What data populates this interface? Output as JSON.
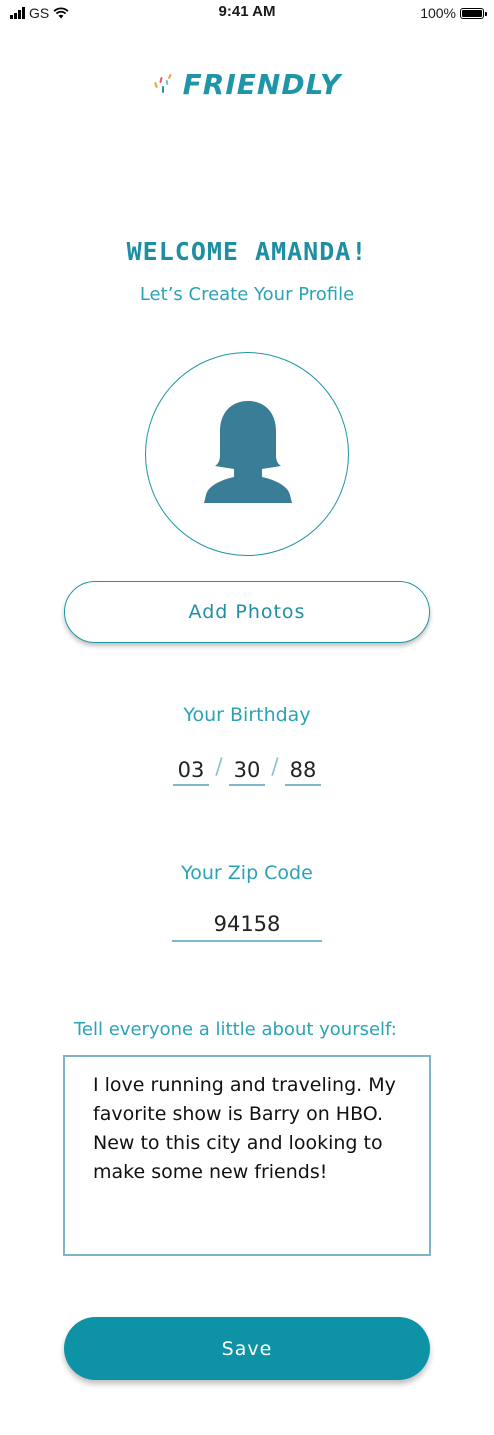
{
  "status_bar": {
    "carrier": "GS",
    "time": "9:41 AM",
    "battery": "100%"
  },
  "app": {
    "name": "FRIENDLY"
  },
  "header": {
    "welcome": "WELCOME AMANDA!",
    "subtitle": "Let’s Create Your Profile"
  },
  "photo": {
    "add_label": "Add Photos"
  },
  "birthday": {
    "label": "Your Birthday",
    "month": "03",
    "day": "30",
    "year": "88",
    "separator": "/"
  },
  "zip": {
    "label": "Your Zip Code",
    "value": "94158"
  },
  "about": {
    "label": "Tell everyone a little about yourself:",
    "text": "I love running and traveling. My favorite show is  Barry on HBO.  New to this city and looking to make some new friends!"
  },
  "actions": {
    "save_label": "Save"
  },
  "colors": {
    "accent": "#1e96a8",
    "avatar_fill": "#3a7d96",
    "save_bg": "#0e93a6"
  },
  "icons": {
    "avatar": "user-silhouette-icon",
    "logo": "confetti-icon"
  }
}
